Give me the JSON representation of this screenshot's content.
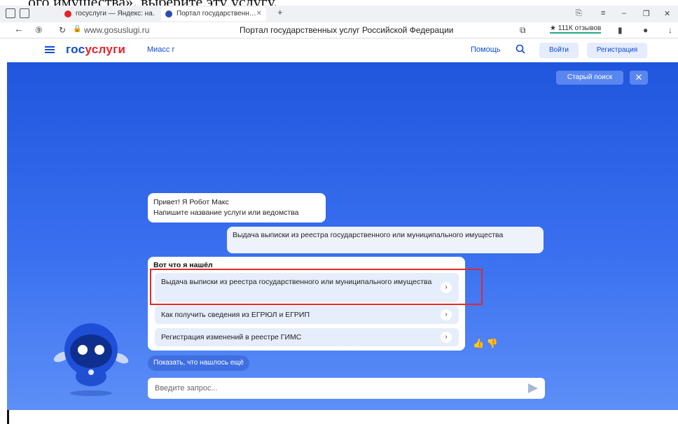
{
  "caption": "ого имущества», выберите эту услугу.",
  "browser": {
    "tabs": [
      {
        "label": "госуслуги — Яндекс: на…",
        "fav_color": "#e5232b"
      },
      {
        "label": "Портал государственн…",
        "fav_color": "#2b4db3",
        "active": true
      }
    ],
    "url": "www.gosuslugi.ru",
    "page_title": "Портал государственных услуг Российской Федерации",
    "reviews": "★ 111К отзывов"
  },
  "header": {
    "logo_a": "гос",
    "logo_b": "услуги",
    "city": "Миасс г",
    "help": "Помощь",
    "login": "Войти",
    "register": "Регистрация"
  },
  "hero": {
    "old_search": "Старый поиск",
    "close": "✕"
  },
  "chat": {
    "greeting_line1": "Привет! Я Робот Макс",
    "greeting_line2": "Напишите название услуги или ведомства",
    "user_query": "Выдача выписки из реестра государственного или муниципального имущества",
    "found_title": "Вот что я нашёл",
    "options": [
      "Выдача выписки из реестра государственного или муниципального имущества",
      "Как получить сведения из ЕГРЮЛ и ЕГРИП",
      "Регистрация изменений в реестре ГИМС"
    ],
    "show_more": "Показать, что нашлось ещё",
    "input_placeholder": "Введите запрос...",
    "like": "👍",
    "dislike": "👎"
  },
  "colors": {
    "brand_blue": "#0d4cd3",
    "brand_red": "#e5232b",
    "highlight": "#e02a2a"
  }
}
